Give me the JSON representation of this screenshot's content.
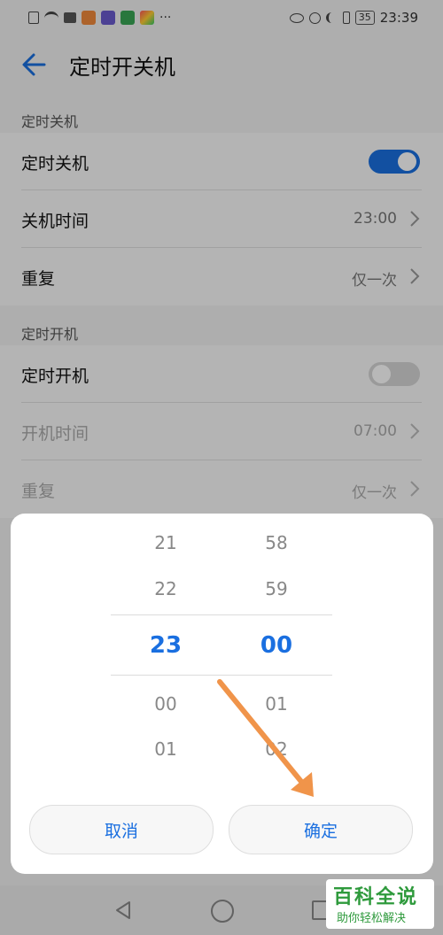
{
  "status_bar": {
    "time": "23:39",
    "battery": "35",
    "more": "···"
  },
  "header": {
    "title": "定时开关机"
  },
  "sections": [
    {
      "header": "定时关机",
      "rows": {
        "toggle_label": "定时关机",
        "toggle_state": "on",
        "time_label": "关机时间",
        "time_value": "23:00",
        "repeat_label": "重复",
        "repeat_value": "仅一次"
      }
    },
    {
      "header": "定时开机",
      "rows": {
        "toggle_label": "定时开机",
        "toggle_state": "off",
        "time_label": "开机时间",
        "time_value": "07:00",
        "repeat_label": "重复",
        "repeat_value": "仅一次"
      }
    }
  ],
  "time_picker": {
    "hours": [
      "21",
      "22",
      "23",
      "00",
      "01"
    ],
    "minutes": [
      "58",
      "59",
      "00",
      "01",
      "02"
    ],
    "selected_hour": "23",
    "selected_minute": "00",
    "cancel_label": "取消",
    "confirm_label": "确定"
  },
  "watermark": {
    "main": "百科全说",
    "sub": "助你轻松解决"
  },
  "colors": {
    "accent": "#1a6fe0",
    "annotation_arrow": "#f0944a",
    "watermark": "#2e9a3c"
  }
}
